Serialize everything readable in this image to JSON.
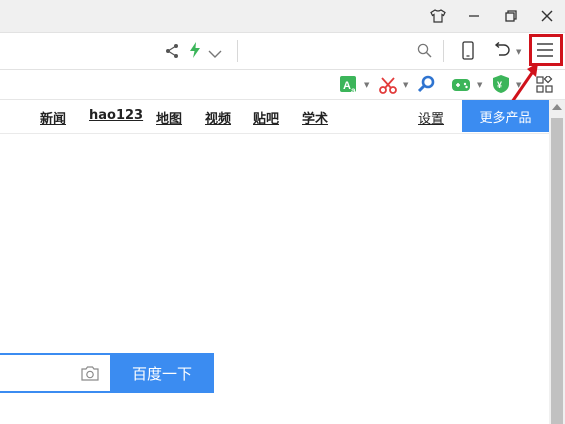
{
  "nav": {
    "links": [
      "新闻",
      "hao123",
      "地图",
      "视频",
      "贴吧",
      "学术"
    ],
    "settings": "设置",
    "more_products": "更多产品"
  },
  "search": {
    "value": "",
    "button_label": "百度一下"
  },
  "colors": {
    "brand_blue": "#3b8cf1",
    "highlight_red": "#d0121b",
    "lightning_green": "#3cb55a"
  },
  "icons": {
    "titlebar": [
      "shirt-skin-icon",
      "minimize-icon",
      "restore-icon",
      "close-icon"
    ],
    "addressbar": [
      "share-icon",
      "lightning-icon",
      "chevron-down-icon",
      "search-icon",
      "mobile-icon",
      "undo-icon",
      "menu-icon"
    ],
    "extensions": [
      "translate-icon",
      "scissors-icon",
      "magnifier-icon",
      "gamepad-icon",
      "shield-icon",
      "apps-grid-icon"
    ]
  }
}
